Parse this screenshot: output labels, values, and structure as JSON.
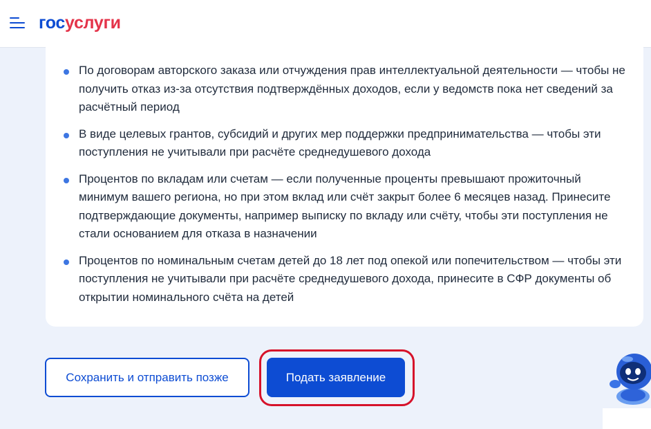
{
  "header": {
    "logo_part1": "гос",
    "logo_part2": "услуги",
    "menu_icon": "menu-icon"
  },
  "info": {
    "items": [
      {
        "text": "По договорам авторского заказа или отчуждения прав интеллектуальной деятельности — чтобы не получить отказ из-за отсутствия подтверждённых доходов, если у ведомств пока нет сведений за расчётный период"
      },
      {
        "text": "В виде целевых грантов, субсидий и других мер поддержки предпринимательства — чтобы эти поступления не учитывали при расчёте среднедушевого дохода"
      },
      {
        "text": "Процентов по вкладам или счетам — если полученные проценты превышают прожиточный минимум вашего региона, но при этом вклад или счёт закрыт более 6 месяцев назад. Принесите подтверждающие документы, например выписку по вкладу или счёту, чтобы эти поступления не стали основанием для отказа в назначении"
      },
      {
        "text": "Процентов по номинальным счетам детей до 18 лет под опекой или попечительством — чтобы эти поступления не учитывали при расчёте среднедушевого дохода, принесите в СФР документы об открытии номинального счёта на детей"
      }
    ]
  },
  "actions": {
    "save_later_label": "Сохранить и отправить позже",
    "submit_label": "Подать заявление"
  },
  "colors": {
    "brand_blue": "#0d4cd3",
    "brand_red": "#e4344a",
    "highlight_red": "#d6122a",
    "page_bg": "#edf2fb"
  },
  "assistant": {
    "icon": "robot-assistant-icon"
  }
}
